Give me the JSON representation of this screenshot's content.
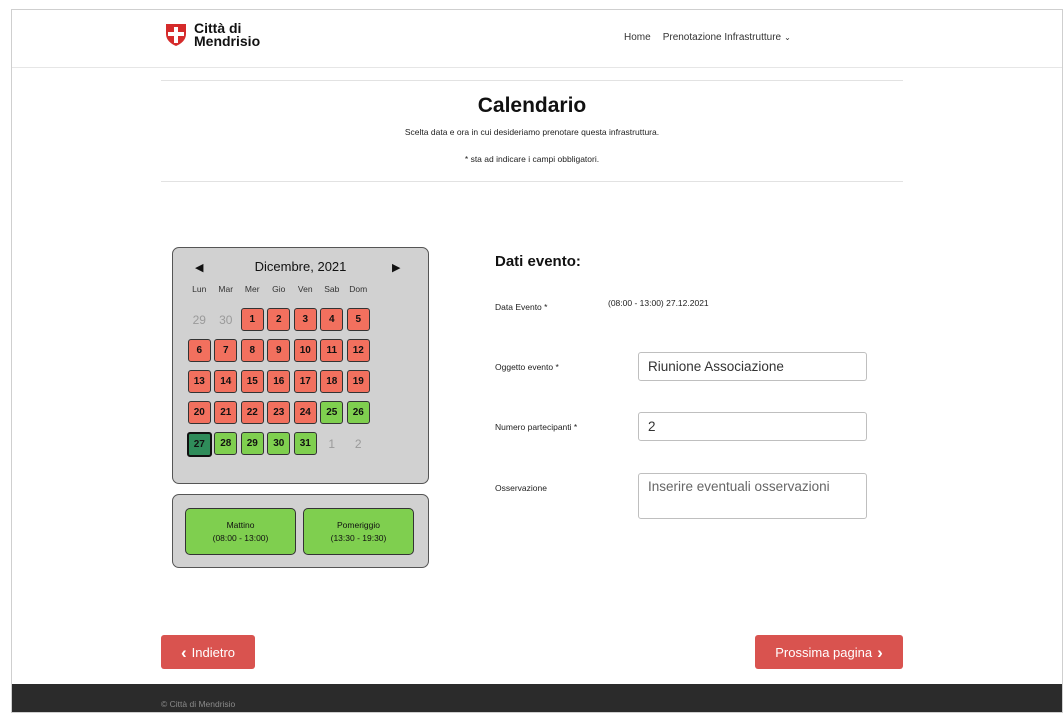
{
  "header": {
    "logo_line1": "Città di",
    "logo_line2": "Mendrisio",
    "nav": {
      "home": "Home",
      "booking": "Prenotazione Infrastrutture",
      "booking_chevron": "⌄"
    }
  },
  "page": {
    "title": "Calendario",
    "subtitle": "Scelta data e ora in cui desideriamo prenotare questa infrastruttura.",
    "required_note": "* sta ad indicare i campi obbligatori."
  },
  "calendar": {
    "prev_arrow": "◀",
    "next_arrow": "▶",
    "month_label": "Dicembre, 2021",
    "weekdays": [
      "Lun",
      "Mar",
      "Mer",
      "Gio",
      "Ven",
      "Sab",
      "Dom"
    ],
    "days": [
      {
        "n": "29",
        "s": "muted"
      },
      {
        "n": "30",
        "s": "muted"
      },
      {
        "n": "1",
        "s": "red"
      },
      {
        "n": "2",
        "s": "red"
      },
      {
        "n": "3",
        "s": "red"
      },
      {
        "n": "4",
        "s": "red"
      },
      {
        "n": "5",
        "s": "red"
      },
      {
        "n": "6",
        "s": "red"
      },
      {
        "n": "7",
        "s": "red"
      },
      {
        "n": "8",
        "s": "red"
      },
      {
        "n": "9",
        "s": "red"
      },
      {
        "n": "10",
        "s": "red"
      },
      {
        "n": "11",
        "s": "red"
      },
      {
        "n": "12",
        "s": "red"
      },
      {
        "n": "13",
        "s": "red"
      },
      {
        "n": "14",
        "s": "red"
      },
      {
        "n": "15",
        "s": "red"
      },
      {
        "n": "16",
        "s": "red"
      },
      {
        "n": "17",
        "s": "red"
      },
      {
        "n": "18",
        "s": "red"
      },
      {
        "n": "19",
        "s": "red"
      },
      {
        "n": "20",
        "s": "red"
      },
      {
        "n": "21",
        "s": "red"
      },
      {
        "n": "22",
        "s": "red"
      },
      {
        "n": "23",
        "s": "red"
      },
      {
        "n": "24",
        "s": "red"
      },
      {
        "n": "25",
        "s": "green"
      },
      {
        "n": "26",
        "s": "green"
      },
      {
        "n": "27",
        "s": "selected"
      },
      {
        "n": "28",
        "s": "green"
      },
      {
        "n": "29",
        "s": "green"
      },
      {
        "n": "30",
        "s": "green"
      },
      {
        "n": "31",
        "s": "green"
      },
      {
        "n": "1",
        "s": "muted"
      },
      {
        "n": "2",
        "s": "muted"
      }
    ],
    "colors": {
      "unavailable": "#f2705e",
      "available": "#7fcf4f",
      "selected": "#2f8c5a"
    }
  },
  "slots": {
    "morning": {
      "name": "Mattino",
      "time": "(08:00 - 13:00)"
    },
    "afternoon": {
      "name": "Pomeriggio",
      "time": "(13:30 - 19:30)"
    }
  },
  "form": {
    "title": "Dati evento:",
    "date_label": "Data Evento *",
    "date_value": "(08:00 - 13:00) 27.12.2021",
    "subject_label": "Oggetto evento *",
    "subject_value": "Riunione Associazione",
    "participants_label": "Numero partecipanti *",
    "participants_value": "2",
    "notes_label": "Osservazione",
    "notes_placeholder": "Inserire eventuali osservazioni"
  },
  "buttons": {
    "back_icon": "‹",
    "back_label": "Indietro",
    "next_label": "Prossima pagina",
    "next_icon": "›"
  },
  "footer": {
    "text": "© Città di Mendrisio"
  }
}
